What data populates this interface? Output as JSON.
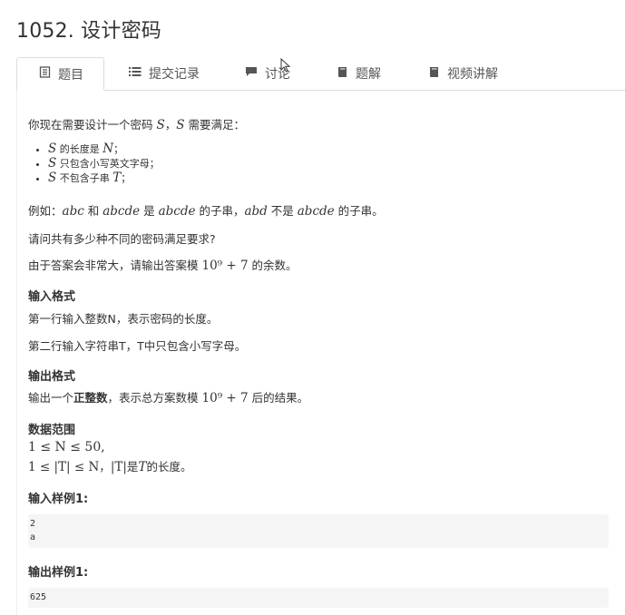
{
  "problem": {
    "title": "1052. 设计密码"
  },
  "tabs": [
    {
      "label": "题目"
    },
    {
      "label": "提交记录"
    },
    {
      "label": "讨论"
    },
    {
      "label": "题解"
    },
    {
      "label": "视频讲解"
    }
  ],
  "statement": {
    "intro_a": "你现在需要设计一个密码 ",
    "intro_var1": "S",
    "intro_sep": "，",
    "intro_var2": "S",
    "intro_b": " 需要满足：",
    "req1_var": "S",
    "req1_a": " 的长度是 ",
    "req1_var2": "N",
    "req1_b": "；",
    "req2_var": "S",
    "req2_a": " 只包含小写英文字母；",
    "req3_var": "S",
    "req3_a": " 不包含子串 ",
    "req3_var2": "T",
    "req3_b": "；",
    "ex_a": "例如：",
    "ex_v1": "abc",
    "ex_b": " 和 ",
    "ex_v2": "abcde",
    "ex_c": " 是 ",
    "ex_v3": "abcde",
    "ex_d": " 的子串，",
    "ex_v4": "abd",
    "ex_e": " 不是 ",
    "ex_v5": "abcde",
    "ex_f": " 的子串。",
    "question": "请问共有多少种不同的密码满足要求?",
    "mod_a": "由于答案会非常大，请输出答案模 ",
    "mod_math": "10⁹ + 7",
    "mod_b": " 的余数。"
  },
  "input_format": {
    "heading": "输入格式",
    "line1": "第一行输入整数N，表示密码的长度。",
    "line2": "第二行输入字符串T，T中只包含小写字母。"
  },
  "output_format": {
    "heading": "输出格式",
    "text_a": "输出一个",
    "text_bold": "正整数",
    "text_b": "，表示总方案数模 ",
    "text_math": "10⁹ + 7",
    "text_c": " 后的结果。"
  },
  "range": {
    "heading": "数据范围",
    "line1": "1 ≤ N ≤ 50,",
    "line2_math": "1 ≤ |T| ≤ N",
    "line2_a": "，",
    "line2_math2": "|T|",
    "line2_b": "是",
    "line2_var": "T",
    "line2_c": "的长度。"
  },
  "sample_input": {
    "heading": "输入样例1:",
    "lines": [
      "2",
      "a"
    ]
  },
  "sample_output": {
    "heading": "输出样例1:",
    "lines": [
      "625"
    ]
  }
}
